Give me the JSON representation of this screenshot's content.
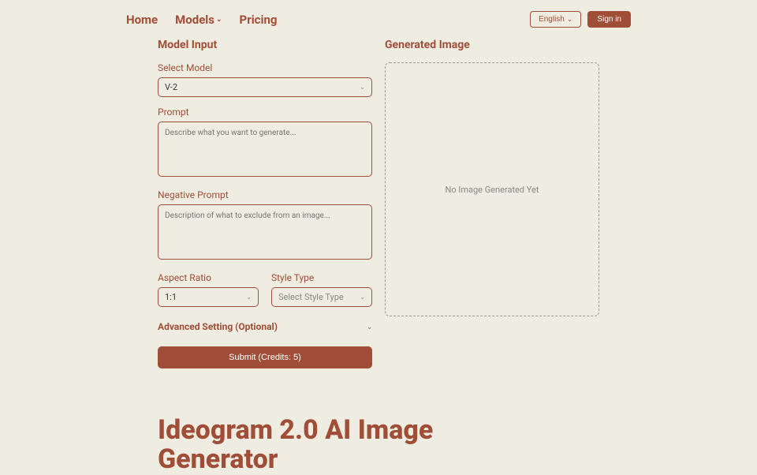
{
  "nav": {
    "home": "Home",
    "models": "Models",
    "pricing": "Pricing"
  },
  "header": {
    "language": "English",
    "signin": "Sign in"
  },
  "form": {
    "title": "Model Input",
    "selectModelLabel": "Select Model",
    "selectModelValue": "V-2",
    "promptLabel": "Prompt",
    "promptPlaceholder": "Describe what you want to generate...",
    "negPromptLabel": "Negative Prompt",
    "negPromptPlaceholder": "Description of what to exclude from an image...",
    "aspectRatioLabel": "Aspect Ratio",
    "aspectRatioValue": "1:1",
    "styleTypeLabel": "Style Type",
    "styleTypePlaceholder": "Select Style Type",
    "advanced": "Advanced Setting (Optional)",
    "submit": "Submit (Credits: 5)"
  },
  "output": {
    "title": "Generated Image",
    "empty": "No Image Generated Yet"
  },
  "hero": {
    "title": "Ideogram 2.0 AI Image Generator"
  }
}
